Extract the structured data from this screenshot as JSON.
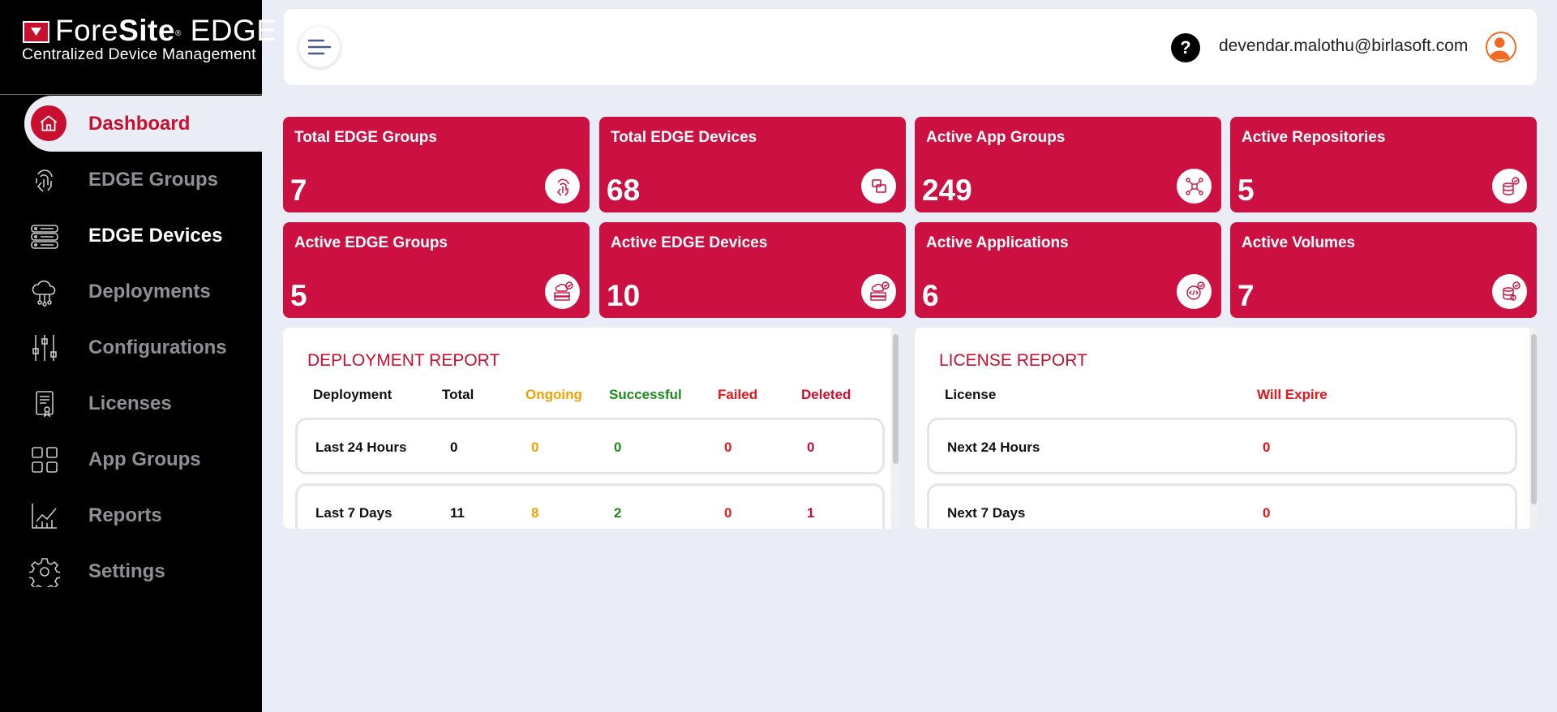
{
  "brand": {
    "name_prefix": "Fore",
    "name_bold": "Site",
    "name_reg": "®",
    "name_suffix": " EDGE",
    "tagline": "Centralized Device Management"
  },
  "sidebar": {
    "items": [
      {
        "label": "Dashboard",
        "icon": "home-icon",
        "state": "active"
      },
      {
        "label": "EDGE Groups",
        "icon": "fingerprint-icon",
        "state": "normal"
      },
      {
        "label": "EDGE Devices",
        "icon": "server-icon",
        "state": "highlighted"
      },
      {
        "label": "Deployments",
        "icon": "cloud-network-icon",
        "state": "normal"
      },
      {
        "label": "Configurations",
        "icon": "sliders-icon",
        "state": "normal"
      },
      {
        "label": "Licenses",
        "icon": "certificate-icon",
        "state": "normal"
      },
      {
        "label": "App Groups",
        "icon": "grid-icon",
        "state": "normal"
      },
      {
        "label": "Reports",
        "icon": "chart-icon",
        "state": "normal"
      },
      {
        "label": "Settings",
        "icon": "gear-icon",
        "state": "normal"
      }
    ]
  },
  "header": {
    "help_label": "?",
    "user_email": "devendar.malothu@birlasoft.com"
  },
  "cards": [
    {
      "title": "Total EDGE Groups",
      "value": "7",
      "icon": "fingerprint-icon"
    },
    {
      "title": "Total EDGE Devices",
      "value": "68",
      "icon": "devices-icon"
    },
    {
      "title": "Active App Groups",
      "value": "249",
      "icon": "network-icon"
    },
    {
      "title": "Active Repositories",
      "value": "5",
      "icon": "database-check-icon"
    },
    {
      "title": "Active EDGE Groups",
      "value": "5",
      "icon": "cloud-server-check-icon"
    },
    {
      "title": "Active EDGE Devices",
      "value": "10",
      "icon": "cloud-server-check-icon"
    },
    {
      "title": "Active Applications",
      "value": "6",
      "icon": "code-gear-icon"
    },
    {
      "title": "Active Volumes",
      "value": "7",
      "icon": "database-gear-icon"
    }
  ],
  "deployment_report": {
    "title": "DEPLOYMENT REPORT",
    "headers": [
      "Deployment",
      "Total",
      "Ongoing",
      "Successful",
      "Failed",
      "Deleted"
    ],
    "rows": [
      [
        "Last 24 Hours",
        "0",
        "0",
        "0",
        "0",
        "0"
      ],
      [
        "Last 7 Days",
        "11",
        "8",
        "2",
        "0",
        "1"
      ]
    ]
  },
  "license_report": {
    "title": "LICENSE REPORT",
    "headers": [
      "License",
      "Will Expire"
    ],
    "rows": [
      [
        "Next 24 Hours",
        "0"
      ],
      [
        "Next 7 Days",
        "0"
      ]
    ]
  },
  "colors": {
    "brand_red": "#c8102e",
    "card_red": "#cc1142",
    "ongoing": "#f5a000",
    "successful": "#1e8a1e",
    "failed": "#e8141b"
  }
}
